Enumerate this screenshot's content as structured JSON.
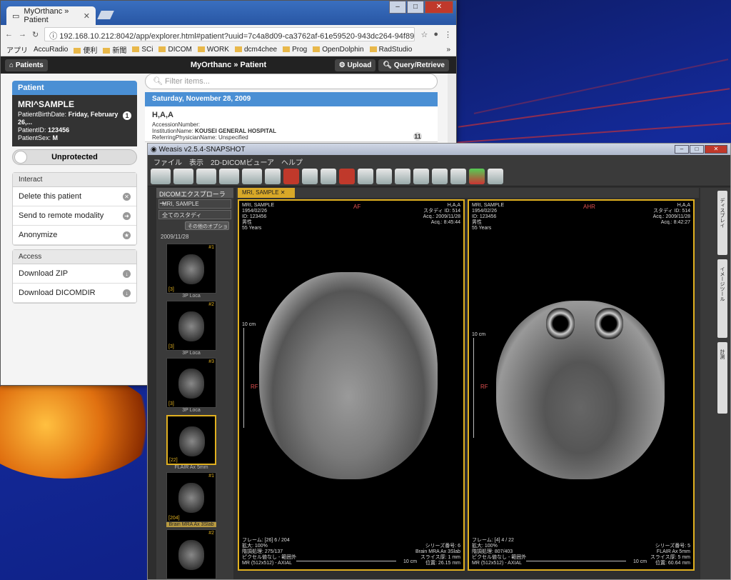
{
  "browser": {
    "tab_title": "MyOrthanc » Patient",
    "url": "192.168.10.212:8042/app/explorer.html#patient?uuid=7c4a8d09-ca3762af-61e59520-943dc264-94f8941b",
    "bookmarks": [
      "アプリ",
      "AccuRadio",
      "便利",
      "新聞",
      "SCi",
      "DICOM",
      "WORK",
      "dcm4chee",
      "Prog",
      "OpenDolphin",
      "RadStudio"
    ],
    "more": "»"
  },
  "app": {
    "patients_button": "Patients",
    "title": "MyOrthanc » Patient",
    "upload_button": "Upload",
    "query_button": "Query/Retrieve",
    "patient_header": "Patient",
    "patient_name": "MRI^SAMPLE",
    "birth_date_label": "PatientBirthDate:",
    "birth_date": "Friday, February 26,...",
    "patient_id_label": "PatientID:",
    "patient_id": "123456",
    "sex_label": "PatientSex:",
    "sex": "M",
    "study_count": "1",
    "protection": "Unprotected",
    "interact_header": "Interact",
    "interact_items": [
      "Delete this patient",
      "Send to remote modality",
      "Anonymize"
    ],
    "access_header": "Access",
    "access_items": [
      "Download ZIP",
      "Download DICOMDIR"
    ],
    "filter_placeholder": "Filter items...",
    "study_date": "Saturday, November 28, 2009",
    "study_name": "H,A,A",
    "accession_label": "AccessionNumber:",
    "institution_label": "InstitutionName:",
    "institution": "KOUSEI GENERAL HOSPITAL",
    "referring_label": "ReferringPhysicianName:",
    "referring": "Unspecified",
    "series_count": "11"
  },
  "weasis": {
    "window_title": "Weasis v2.5.4-SNAPSHOT",
    "menu": [
      "ファイル",
      "表示",
      "2D-DICOMビューア",
      "ヘルプ"
    ],
    "explorer_tab": "DICOMエクスプローラー",
    "patient_select": "MRI, SAMPLE",
    "study_select": "全てのスタディ",
    "options_button": "その他のオプション",
    "date": "2009/11/28",
    "thumbs": [
      {
        "num": "#1",
        "count": "[3]",
        "label": "3P Loca"
      },
      {
        "num": "#2",
        "count": "[3]",
        "label": "3P Loca"
      },
      {
        "num": "#3",
        "count": "[3]",
        "label": "3P Loca"
      },
      {
        "num": "",
        "count": "[22]",
        "label": "FLAIR Ax 5mm"
      },
      {
        "num": "#1",
        "count": "[204]",
        "label": "Brain MRA Ax 3Slab"
      },
      {
        "num": "#2",
        "count": "",
        "label": ""
      }
    ],
    "viewer_tab": "MRI, SAMPLE",
    "right_labels": [
      "ディスプレイ",
      "イメージツール",
      "計測"
    ],
    "views": [
      {
        "tl": [
          "MRI, SAMPLE",
          "1954/02/26",
          "ID: 123456",
          "男性",
          "55 Years"
        ],
        "tr": [
          "H,A,A",
          "スタディ ID: 514",
          "Acq.: 2009/11/28",
          "Acq.: 8:45:44"
        ],
        "orient_top": "AF",
        "orient_left": "RF",
        "scale": "10 cm",
        "bl": [
          "フレーム: [26] 6 / 204",
          "拡大: 100%",
          "階調処理: 275/137",
          "ピクセル値なし - 範囲外",
          "MR (512x512) - AXIAL"
        ],
        "br": [
          "シリーズ番号: 6",
          "Brain MRA Ax 3Slab",
          "スライス厚: 1 mm",
          "位置: 26.15 mm"
        ],
        "hscale": "10 cm"
      },
      {
        "tl": [
          "MRI, SAMPLE",
          "1954/02/26",
          "ID: 123456",
          "男性",
          "55 Years"
        ],
        "tr": [
          "H,A,A",
          "スタディ ID: 514",
          "Acq.: 2009/11/28",
          "Acq.: 8:42:27"
        ],
        "orient_top": "AHR",
        "orient_left": "RF",
        "scale": "10 cm",
        "bl": [
          "フレーム: [4] 4 / 22",
          "拡大: 100%",
          "階調処理: 807/403",
          "ピクセル値なし - 範囲外",
          "MR (512x512) - AXIAL"
        ],
        "br": [
          "シリーズ番号: 5",
          "FLAIR Ax 5mm",
          "スライス厚: 5 mm",
          "位置: 60.64 mm"
        ],
        "hscale": "10 cm"
      }
    ]
  }
}
